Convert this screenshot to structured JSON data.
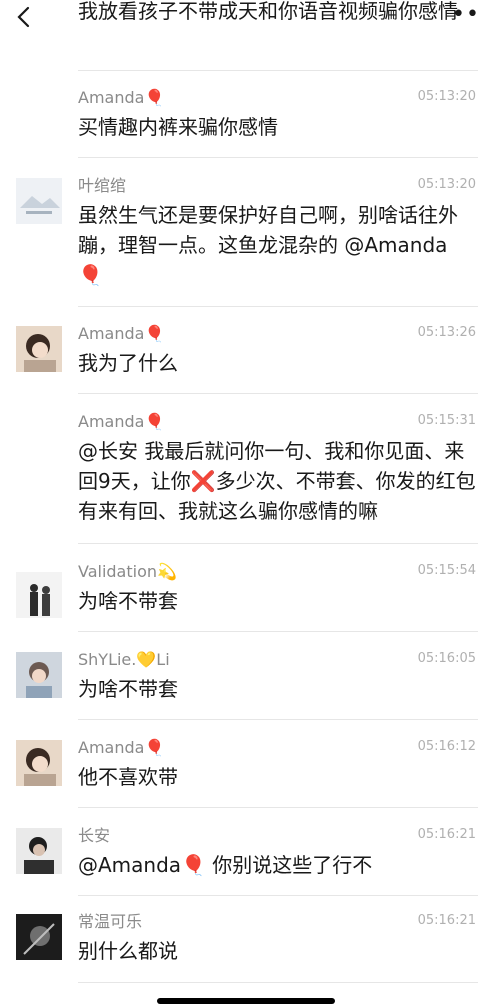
{
  "header": {
    "top_message": "我放看孩子不带成天和你语音视频骗你感情",
    "more_icon": "ellipsis"
  },
  "messages": [
    {
      "name": "Amanda",
      "emoji": "🎈",
      "time": "05:13:20",
      "text": "买情趣内裤来骗你感情"
    },
    {
      "name": "叶绾绾",
      "emoji": "",
      "time": "05:13:20",
      "text": "虽然生气还是要保护好自己啊，别啥话往外蹦，理智一点。这鱼龙混杂的 @Amanda",
      "text_emoji": "🎈"
    },
    {
      "name": "Amanda",
      "emoji": "🎈",
      "time": "05:13:26",
      "text": "我为了什么"
    },
    {
      "name": "Amanda",
      "emoji": "🎈",
      "time": "05:15:31",
      "text_parts": [
        "@长安 我最后就问你一句、我和你见面、来回9天，让你",
        "❌",
        "多少次、不带套、你发的红包有来有回、我就这么骗你感情的嘛"
      ]
    },
    {
      "name": "Validation",
      "emoji": "💫",
      "time": "05:15:54",
      "text": "为啥不带套"
    },
    {
      "name": "ShYLie.",
      "emoji": "💛",
      "name_suffix": "Li",
      "time": "05:16:05",
      "text": "为啥不带套"
    },
    {
      "name": "Amanda",
      "emoji": "🎈",
      "time": "05:16:12",
      "text": "他不喜欢带"
    },
    {
      "name": "长安",
      "emoji": "",
      "time": "05:16:21",
      "text": "@Amanda",
      "text_emoji": "🎈",
      "text_after": " 你别说这些了行不"
    },
    {
      "name": "常温可乐",
      "emoji": "",
      "time": "05:16:21",
      "text": "别什么都说"
    }
  ],
  "colors": {
    "balloon": "#e22a2a",
    "name": "#8a8a8a",
    "time": "#b0b0b0",
    "divider": "#e6e6e6"
  }
}
